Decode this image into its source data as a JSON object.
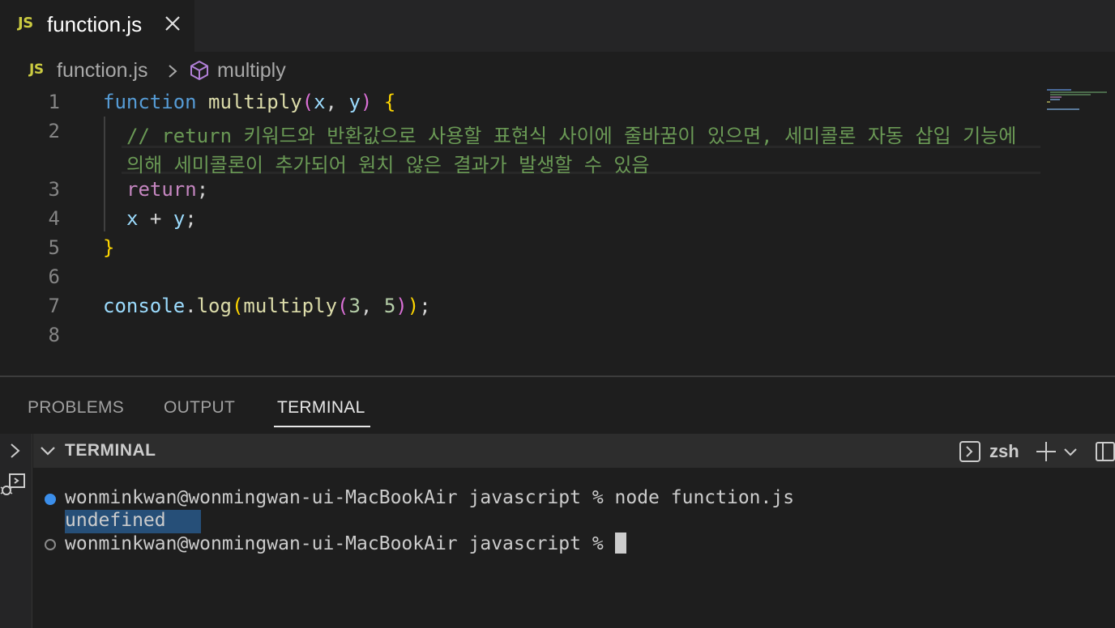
{
  "tab": {
    "badge": "JS",
    "title": "function.js"
  },
  "breadcrumb": {
    "badge": "JS",
    "file": "function.js",
    "symbol": "multiply"
  },
  "editor": {
    "line_numbers": [
      "1",
      "2",
      "3",
      "4",
      "5",
      "6",
      "7",
      "8"
    ],
    "lines": {
      "l1_kw": "function",
      "l1_fn": "multiply",
      "l1_open": "(",
      "l1_x": "x",
      "l1_comma": ", ",
      "l1_y": "y",
      "l1_close": ")",
      "l1_brace": "{",
      "l2_comment": "// return 키워드와 반환값으로 사용할 표현식 사이에 줄바꿈이 있으면, 세미콜론 자동 삽입 기능에",
      "l2b_comment": "의해 세미콜론이 추가되어 원치 않은 결과가 발생할 수 있음",
      "l3_return": "return",
      "l3_semi": ";",
      "l4_x": "x",
      "l4_op": " + ",
      "l4_y": "y",
      "l4_semi": ";",
      "l5_brace": "}",
      "l7_obj": "console",
      "l7_dot": ".",
      "l7_method": "log",
      "l7_open1": "(",
      "l7_fn": "multiply",
      "l7_open2": "(",
      "l7_n1": "3",
      "l7_comma": ", ",
      "l7_n2": "5",
      "l7_close2": ")",
      "l7_close1": ")",
      "l7_semi": ";"
    }
  },
  "panel": {
    "tabs": [
      "PROBLEMS",
      "OUTPUT",
      "TERMINAL"
    ],
    "active_tab": "TERMINAL",
    "terminal_title": "TERMINAL",
    "shell": "zsh"
  },
  "terminal": {
    "line1": "wonminkwan@wonmingwan-ui-MacBookAir javascript % node function.js",
    "output": "undefined",
    "line3": "wonminkwan@wonmingwan-ui-MacBookAir javascript % "
  },
  "colors": {
    "editor_bg": "#1e1e1e",
    "keyword": "#569cd6",
    "function": "#dcdcaa",
    "comment": "#6a9955",
    "control": "#c586c0",
    "selection": "#264f78",
    "success_dot": "#3b8eea"
  },
  "icons": {
    "tab_close": "close-icon",
    "breadcrumb_sep": "chevron-right-icon",
    "symbol": "cube-icon",
    "terminal_launch": "terminal-icon",
    "add": "plus-icon",
    "dropdown": "chevron-down-icon",
    "split": "split-panel-icon"
  }
}
